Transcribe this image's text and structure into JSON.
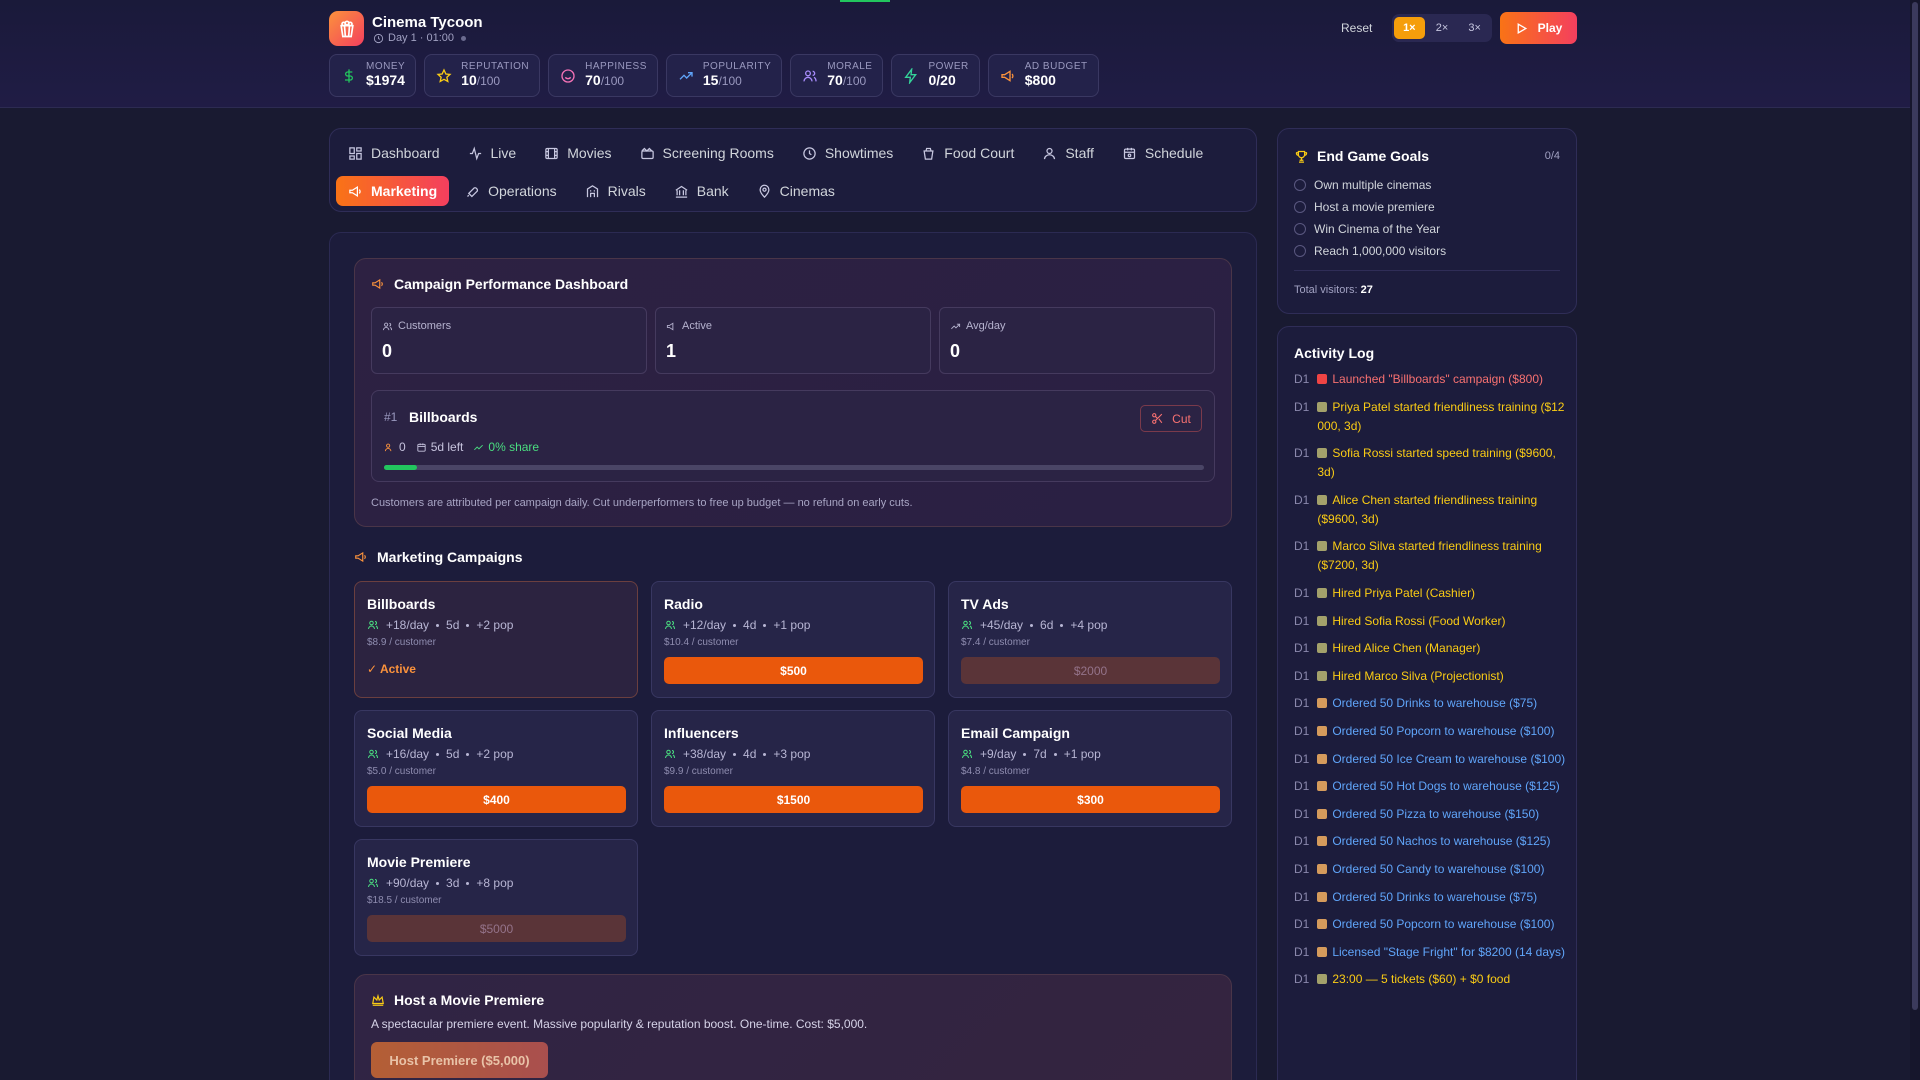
{
  "app": {
    "title": "Cinema Tycoon",
    "day_time": "Day 1 · 01:00"
  },
  "stats": [
    {
      "label": "MONEY",
      "value": "$1974",
      "of": "",
      "icon": "dollar-icon",
      "color": "#22c55e"
    },
    {
      "label": "REPUTATION",
      "value": "10",
      "of": "/100",
      "icon": "star-icon",
      "color": "#facc15"
    },
    {
      "label": "HAPPINESS",
      "value": "70",
      "of": "/100",
      "icon": "smile-icon",
      "color": "#f472b6"
    },
    {
      "label": "POPULARITY",
      "value": "15",
      "of": "/100",
      "icon": "trend-icon",
      "color": "#60a5fa"
    },
    {
      "label": "MORALE",
      "value": "70",
      "of": "/100",
      "icon": "users-icon",
      "color": "#a78bfa"
    },
    {
      "label": "POWER",
      "value": "0/20",
      "of": "",
      "icon": "bolt-icon",
      "color": "#34d399"
    },
    {
      "label": "AD BUDGET",
      "value": "$800",
      "of": "",
      "icon": "megaphone-icon",
      "color": "#fb923c"
    }
  ],
  "controls": {
    "reset": "Reset",
    "speeds": [
      "1×",
      "2×",
      "3×"
    ],
    "active_speed": "1×",
    "play": "Play"
  },
  "tabs_row1": [
    "Dashboard",
    "Live",
    "Movies",
    "Screening Rooms",
    "Showtimes",
    "Food Court",
    "Staff",
    "Schedule"
  ],
  "tabs_row2": [
    "Marketing",
    "Operations",
    "Rivals",
    "Bank",
    "Cinemas"
  ],
  "active_tab": "Marketing",
  "performance": {
    "title": "Campaign Performance Dashboard",
    "kpis": [
      {
        "label": "Customers",
        "value": "0"
      },
      {
        "label": "Active",
        "value": "1"
      },
      {
        "label": "Avg/day",
        "value": "0"
      }
    ],
    "campaign": {
      "num": "#1",
      "name": "Billboards",
      "customers": "0",
      "left": "5d left",
      "share": "0% share",
      "progress": 0.04,
      "cut": "Cut"
    },
    "note": "Customers are attributed per campaign daily. Cut underperformers to free up budget — no refund on early cuts."
  },
  "campaigns_title": "Marketing Campaigns",
  "campaigns": [
    {
      "name": "Billboards",
      "rate": "+18/day",
      "dur": "5d",
      "pop": "+2 pop",
      "cost": "$8.9 / customer",
      "price": "",
      "active": "✓ Active",
      "state": "active"
    },
    {
      "name": "Radio",
      "rate": "+12/day",
      "dur": "4d",
      "pop": "+1 pop",
      "cost": "$10.4 / customer",
      "price": "$500",
      "active": "",
      "state": "buy"
    },
    {
      "name": "TV Ads",
      "rate": "+45/day",
      "dur": "6d",
      "pop": "+4 pop",
      "cost": "$7.4 / customer",
      "price": "$2000",
      "active": "",
      "state": "disabled"
    },
    {
      "name": "Social Media",
      "rate": "+16/day",
      "dur": "5d",
      "pop": "+2 pop",
      "cost": "$5.0 / customer",
      "price": "$400",
      "active": "",
      "state": "buy"
    },
    {
      "name": "Influencers",
      "rate": "+38/day",
      "dur": "4d",
      "pop": "+3 pop",
      "cost": "$9.9 / customer",
      "price": "$1500",
      "active": "",
      "state": "buy"
    },
    {
      "name": "Email Campaign",
      "rate": "+9/day",
      "dur": "7d",
      "pop": "+1 pop",
      "cost": "$4.8 / customer",
      "price": "$300",
      "active": "",
      "state": "buy"
    },
    {
      "name": "Movie Premiere",
      "rate": "+90/day",
      "dur": "3d",
      "pop": "+8 pop",
      "cost": "$18.5 / customer",
      "price": "$5000",
      "active": "",
      "state": "disabled"
    }
  ],
  "premiere": {
    "title": "Host a Movie Premiere",
    "desc": "A spectacular premiere event. Massive popularity & reputation boost. One-time. Cost: $5,000.",
    "button": "Host Premiere ($5,000)"
  },
  "goals": {
    "title": "End Game Goals",
    "count": "0/4",
    "items": [
      "Own multiple cinemas",
      "Host a movie premiere",
      "Win Cinema of the Year",
      "Reach 1,000,000 visitors"
    ],
    "visitors_label": "Total visitors:",
    "visitors_value": "27"
  },
  "log": {
    "title": "Activity Log",
    "entries": [
      {
        "day": "D1",
        "text": "Launched \"Billboards\" campaign ($800)",
        "kind": "red"
      },
      {
        "day": "D1",
        "text": "Priya Patel started friendliness training ($12 000, 3d)",
        "kind": "yel"
      },
      {
        "day": "D1",
        "text": "Sofia Rossi started speed training ($9600, 3d)",
        "kind": "yel"
      },
      {
        "day": "D1",
        "text": "Alice Chen started friendliness training ($9600, 3d)",
        "kind": "yel"
      },
      {
        "day": "D1",
        "text": "Marco Silva started friendliness training ($7200, 3d)",
        "kind": "yel"
      },
      {
        "day": "D1",
        "text": "Hired Priya Patel (Cashier)",
        "kind": "yel"
      },
      {
        "day": "D1",
        "text": "Hired Sofia Rossi (Food Worker)",
        "kind": "yel"
      },
      {
        "day": "D1",
        "text": "Hired Alice Chen (Manager)",
        "kind": "yel"
      },
      {
        "day": "D1",
        "text": "Hired Marco Silva (Projectionist)",
        "kind": "yel"
      },
      {
        "day": "D1",
        "text": "Ordered 50 Drinks to warehouse ($75)",
        "kind": "blu"
      },
      {
        "day": "D1",
        "text": "Ordered 50 Popcorn to warehouse ($100)",
        "kind": "blu"
      },
      {
        "day": "D1",
        "text": "Ordered 50 Ice Cream to warehouse ($100)",
        "kind": "blu"
      },
      {
        "day": "D1",
        "text": "Ordered 50 Hot Dogs to warehouse ($125)",
        "kind": "blu"
      },
      {
        "day": "D1",
        "text": "Ordered 50 Pizza to warehouse ($150)",
        "kind": "blu"
      },
      {
        "day": "D1",
        "text": "Ordered 50 Nachos to warehouse ($125)",
        "kind": "blu"
      },
      {
        "day": "D1",
        "text": "Ordered 50 Candy to warehouse ($100)",
        "kind": "blu"
      },
      {
        "day": "D1",
        "text": "Ordered 50 Drinks to warehouse ($75)",
        "kind": "blu"
      },
      {
        "day": "D1",
        "text": "Ordered 50 Popcorn to warehouse ($100)",
        "kind": "blu"
      },
      {
        "day": "D1",
        "text": "Licensed \"Stage Fright\" for $8200 (14 days)",
        "kind": "blu"
      },
      {
        "day": "D1",
        "text": "23:00 — 5 tickets ($60) + $0 food",
        "kind": "yel"
      }
    ]
  }
}
